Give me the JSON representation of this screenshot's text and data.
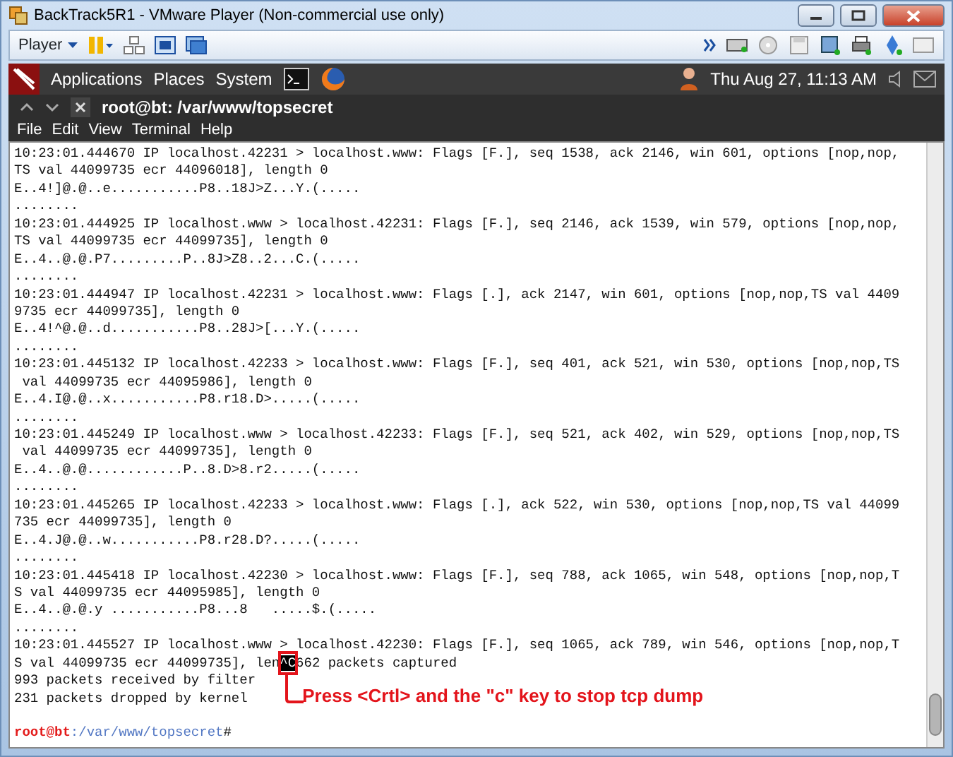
{
  "window": {
    "title": "BackTrack5R1 - VMware Player (Non-commercial use only)"
  },
  "player_toolbar": {
    "menu": "Player"
  },
  "panel": {
    "menus": [
      "Applications",
      "Places",
      "System"
    ],
    "clock": "Thu Aug 27, 11:13 AM"
  },
  "terminal": {
    "title": "root@bt: /var/www/topsecret",
    "menus": [
      "File",
      "Edit",
      "View",
      "Terminal",
      "Help"
    ],
    "lines": [
      {
        "kind": "text",
        "text": "10:23:01.444670 IP localhost.42231 > localhost.www: Flags [F.], seq 1538, ack 2146, win 601, options [nop,nop,"
      },
      {
        "kind": "text",
        "text": "TS val 44099735 ecr 44096018], length 0"
      },
      {
        "kind": "text",
        "text": "E..4!]@.@..e...........P8..18J>Z...Y.(....."
      },
      {
        "kind": "text",
        "text": "........"
      },
      {
        "kind": "text",
        "text": "10:23:01.444925 IP localhost.www > localhost.42231: Flags [F.], seq 2146, ack 1539, win 579, options [nop,nop,"
      },
      {
        "kind": "text",
        "text": "TS val 44099735 ecr 44099735], length 0"
      },
      {
        "kind": "text",
        "text": "E..4..@.@.P7.........P..8J>Z8..2...C.(....."
      },
      {
        "kind": "text",
        "text": "........"
      },
      {
        "kind": "text",
        "text": "10:23:01.444947 IP localhost.42231 > localhost.www: Flags [.], ack 2147, win 601, options [nop,nop,TS val 4409"
      },
      {
        "kind": "text",
        "text": "9735 ecr 44099735], length 0"
      },
      {
        "kind": "text",
        "text": "E..4!^@.@..d...........P8..28J>[...Y.(....."
      },
      {
        "kind": "text",
        "text": "........"
      },
      {
        "kind": "text",
        "text": "10:23:01.445132 IP localhost.42233 > localhost.www: Flags [F.], seq 401, ack 521, win 530, options [nop,nop,TS"
      },
      {
        "kind": "text",
        "text": " val 44099735 ecr 44095986], length 0"
      },
      {
        "kind": "text",
        "text": "E..4.I@.@..x...........P8.r18.D>.....(....."
      },
      {
        "kind": "text",
        "text": "........"
      },
      {
        "kind": "text",
        "text": "10:23:01.445249 IP localhost.www > localhost.42233: Flags [F.], seq 521, ack 402, win 529, options [nop,nop,TS"
      },
      {
        "kind": "text",
        "text": " val 44099735 ecr 44099735], length 0"
      },
      {
        "kind": "text",
        "text": "E..4..@.@............P..8.D>8.r2.....(....."
      },
      {
        "kind": "text",
        "text": "........"
      },
      {
        "kind": "text",
        "text": "10:23:01.445265 IP localhost.42233 > localhost.www: Flags [.], ack 522, win 530, options [nop,nop,TS val 44099"
      },
      {
        "kind": "text",
        "text": "735 ecr 44099735], length 0"
      },
      {
        "kind": "text",
        "text": "E..4.J@.@..w...........P8.r28.D?.....(....."
      },
      {
        "kind": "text",
        "text": "........"
      },
      {
        "kind": "text",
        "text": "10:23:01.445418 IP localhost.42230 > localhost.www: Flags [F.], seq 788, ack 1065, win 548, options [nop,nop,T"
      },
      {
        "kind": "text",
        "text": "S val 44099735 ecr 44095985], length 0"
      },
      {
        "kind": "text",
        "text": "E..4..@.@.y ...........P8...8   .....$.(....."
      },
      {
        "kind": "text",
        "text": "........"
      },
      {
        "kind": "text",
        "text": "10:23:01.445527 IP localhost.www > localhost.42230: Flags [F.], seq 1065, ack 789, win 546, options [nop,nop,T"
      },
      {
        "kind": "interrupt",
        "before": "S val 44099735 ecr 44099735], len",
        "highlight": "^C",
        "after": "662 packets captured",
        "note": "Press <Crtl> and the \"c\" key to stop tcp dump"
      },
      {
        "kind": "text",
        "text": "993 packets received by filter"
      },
      {
        "kind": "text",
        "text": "231 packets dropped by kernel"
      },
      {
        "kind": "blank"
      },
      {
        "kind": "prompt",
        "user": "root@bt",
        "path": ":/var/www/topsecret",
        "symbol": "#"
      }
    ]
  }
}
